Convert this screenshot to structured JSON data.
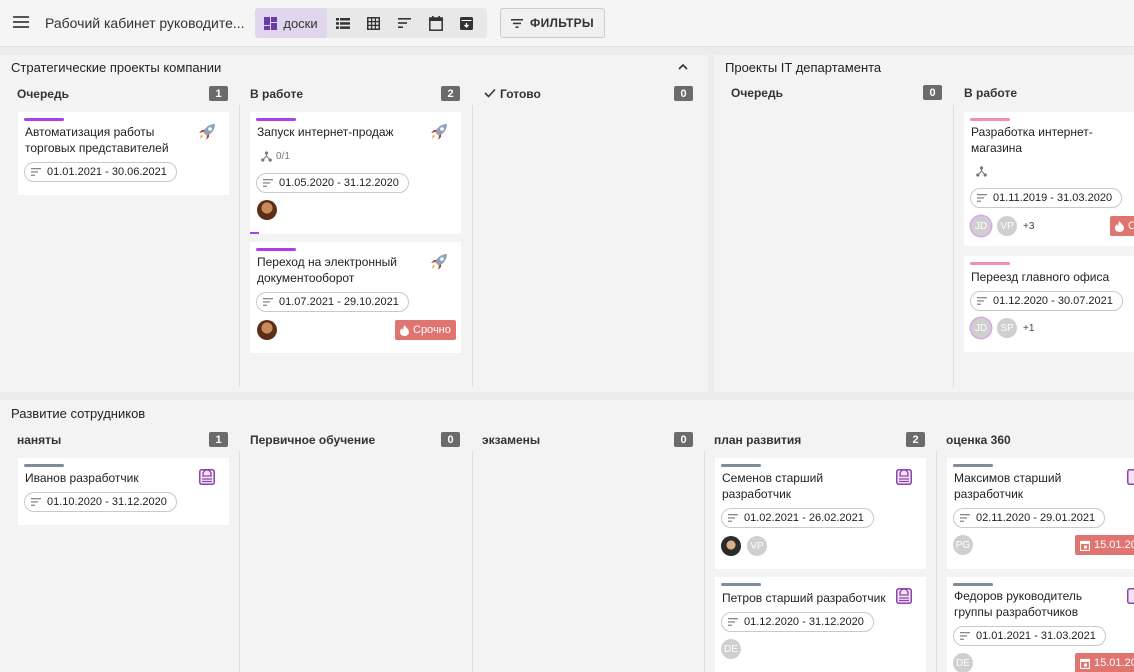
{
  "app": {
    "title": "Рабочий кабинет руководите...",
    "view_active": "доски",
    "filters_label": "ФИЛЬТРЫ"
  },
  "boards": [
    {
      "title": "Стратегические проекты компании",
      "columns": [
        {
          "name": "Очередь",
          "count": "1"
        },
        {
          "name": "В работе",
          "count": "2"
        },
        {
          "name": "Готово",
          "count": "0"
        }
      ],
      "cards": [
        {
          "title_l1": "Автоматизация работы",
          "title_l2": "торговых представителей",
          "dates": "01.01.2021 - 30.06.2021",
          "stripe": "#b23ee6"
        },
        {
          "title_l1": "Запуск интернет-продаж",
          "subtasks": "0/1",
          "dates": "01.05.2020 - 31.12.2020",
          "stripe": "#b23ee6"
        },
        {
          "title_l1": "Переход на электронный",
          "title_l2": "документооборот",
          "dates": "01.07.2021 - 29.10.2021",
          "badge": "Срочно",
          "stripe": "#b23ee6"
        }
      ]
    },
    {
      "title": "Проекты IT департамента",
      "columns": [
        {
          "name": "Очередь",
          "count": "0"
        },
        {
          "name": "В работе"
        }
      ],
      "cards": [
        {
          "title_l1": "Разработка интернет-",
          "title_l2": "магазина",
          "dates": "01.11.2019 - 31.03.2020",
          "avatars": [
            "JD",
            "VP"
          ],
          "more": "+3",
          "badge": "С",
          "stripe": "#f08fb0"
        },
        {
          "title_l1": "Переезд главного офиса",
          "dates": "01.12.2020 - 30.07.2021",
          "avatars": [
            "JD",
            "SP"
          ],
          "more": "+1",
          "stripe": "#f08fb0"
        }
      ]
    },
    {
      "title": "Развитие сотрудников",
      "columns": [
        {
          "name": "наняты",
          "count": "1"
        },
        {
          "name": "Первичное обучение",
          "count": "0"
        },
        {
          "name": "экзамены",
          "count": "0"
        },
        {
          "name": "план развития",
          "count": "2"
        },
        {
          "name": "оценка 360"
        }
      ],
      "cards": [
        {
          "title_l1": "Иванов разработчик",
          "dates": "01.10.2020 - 31.12.2020",
          "stripe": "#7f8c9a"
        },
        {
          "title_l1": "Семенов старший",
          "title_l2": "разработчик",
          "dates": "01.02.2021 - 26.02.2021",
          "avatars": [
            "VP"
          ],
          "stripe": "#7f8c9a"
        },
        {
          "title_l1": "Петров старший разработчик",
          "dates": "01.12.2020 - 31.12.2020",
          "avatars": [
            "DE"
          ],
          "stripe": "#7f8c9a"
        },
        {
          "title_l1": "Максимов старший",
          "title_l2": "разработчик",
          "dates": "02.11.2020 - 29.01.2021",
          "avatars": [
            "PG"
          ],
          "due": "15.01.20",
          "stripe": "#7f8c9a"
        },
        {
          "title_l1": "Федоров руководитель",
          "title_l2": "группы разработчиков",
          "dates": "01.01.2021 - 31.03.2021",
          "avatars": [
            "DE"
          ],
          "due": "15.01.20",
          "stripe": "#7f8c9a"
        }
      ]
    }
  ],
  "colors": {
    "accent": "#b23ee6",
    "urgent": "#e07470",
    "badge_gray": "#6b6b6b",
    "view_active_bg": "#e0d6ee",
    "template_icon": "#8e44ad"
  },
  "icons": [
    "menu-icon",
    "dashboard-icon",
    "list-icon",
    "grid-icon",
    "sort-icon",
    "calendar-icon",
    "archive-icon",
    "filter-icon",
    "chevron-up-icon",
    "check-icon",
    "rocket-icon",
    "subtasks-icon",
    "date-lines-icon",
    "fire-icon",
    "template-icon",
    "calendar-small-icon"
  ]
}
